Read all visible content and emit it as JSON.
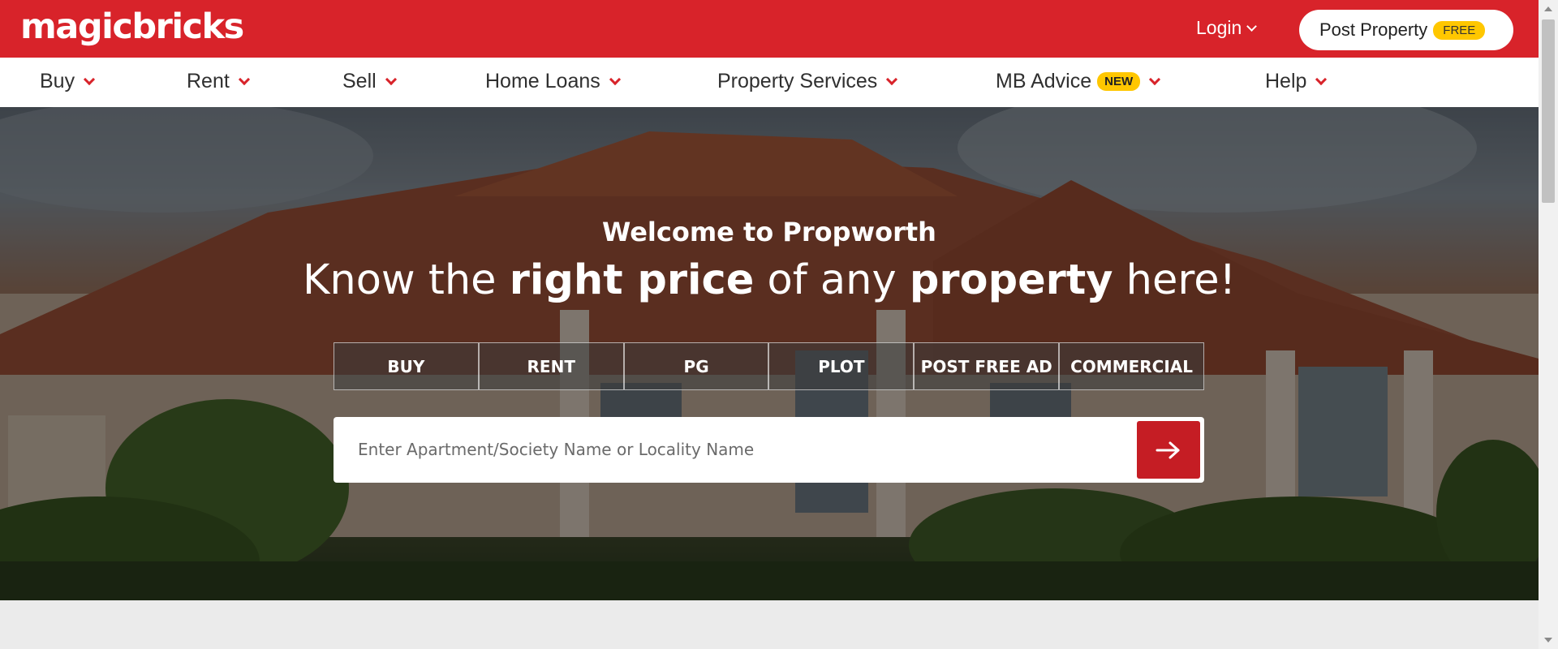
{
  "brand": {
    "logo_text": "magicbricks",
    "color": "#d8232a",
    "accent": "#ffc700"
  },
  "header": {
    "login_label": "Login",
    "post_property_label": "Post Property",
    "post_property_badge": "FREE"
  },
  "nav": {
    "items": [
      {
        "label": "Buy"
      },
      {
        "label": "Rent"
      },
      {
        "label": "Sell"
      },
      {
        "label": "Home Loans"
      },
      {
        "label": "Property Services"
      },
      {
        "label": "MB Advice",
        "badge": "NEW"
      },
      {
        "label": "Help"
      }
    ]
  },
  "hero": {
    "welcome": "Welcome to Propworth",
    "headline": {
      "part1": "Know the ",
      "part2": "right price",
      "part3": " of any ",
      "part4": "property",
      "part5": " here!"
    },
    "tabs": [
      "BUY",
      "RENT",
      "PG",
      "PLOT",
      "POST FREE AD",
      "COMMERCIAL"
    ],
    "search": {
      "placeholder": "Enter Apartment/Society Name or Locality Name",
      "value": ""
    }
  },
  "icons": {
    "search_button": "arrow-right-icon",
    "dropdown": "chevron-down-icon"
  }
}
